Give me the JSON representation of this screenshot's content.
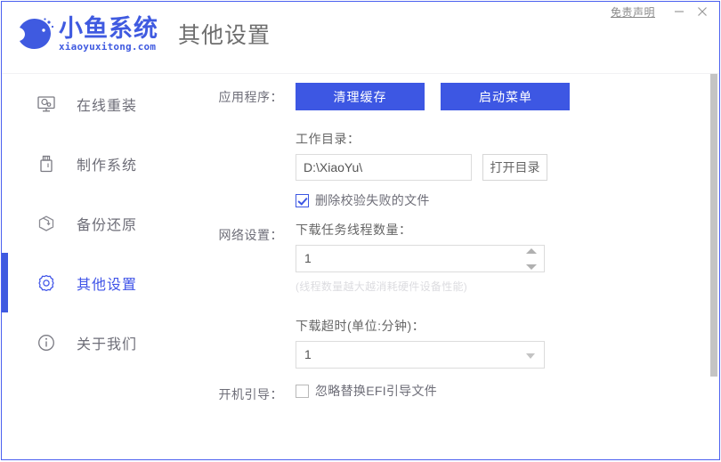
{
  "window": {
    "disclaimer_label": "免责声明",
    "minimize_label": "−",
    "close_label": "✕"
  },
  "header": {
    "brand_cn": "小鱼系统",
    "brand_en": "xiaoyuxitong.com",
    "page_title": "其他设置"
  },
  "sidebar": {
    "items": [
      {
        "icon": "monitor-icon",
        "label": "在线重装",
        "active": false
      },
      {
        "icon": "usb-drive-icon",
        "label": "制作系统",
        "active": false
      },
      {
        "icon": "box-restore-icon",
        "label": "备份还原",
        "active": false
      },
      {
        "icon": "gear-icon",
        "label": "其他设置",
        "active": true
      },
      {
        "icon": "info-icon",
        "label": "关于我们",
        "active": false
      }
    ]
  },
  "main": {
    "app_section": {
      "row_label": "应用程序：",
      "clear_cache_label": "清理缓存",
      "start_menu_label": "启动菜单",
      "work_dir_label": "工作目录：",
      "work_dir_value": "D:\\XiaoYu\\",
      "work_dir_placeholder": "D:\\XiaoYu\\",
      "open_dir_label": "打开目录",
      "delete_failed_label": "删除校验失败的文件",
      "delete_failed_checked": true
    },
    "network_section": {
      "row_label": "网络设置：",
      "thread_count_label": "下载任务线程数量：",
      "thread_count_value": "1",
      "thread_hint": "(线程数量越大越消耗硬件设备性能)",
      "timeout_label": "下载超时(单位:分钟)：",
      "timeout_value": "1"
    },
    "boot_section": {
      "row_label": "开机引导：",
      "ignore_efi_label": "忽略替换EFI引导文件",
      "ignore_efi_checked": false
    }
  },
  "colors": {
    "brand_blue": "#3f5ae0",
    "button_blue": "#3d57e3",
    "active_text": "#4054e8",
    "body_text": "#6e6e78",
    "hint_gray": "#dcdce0"
  }
}
